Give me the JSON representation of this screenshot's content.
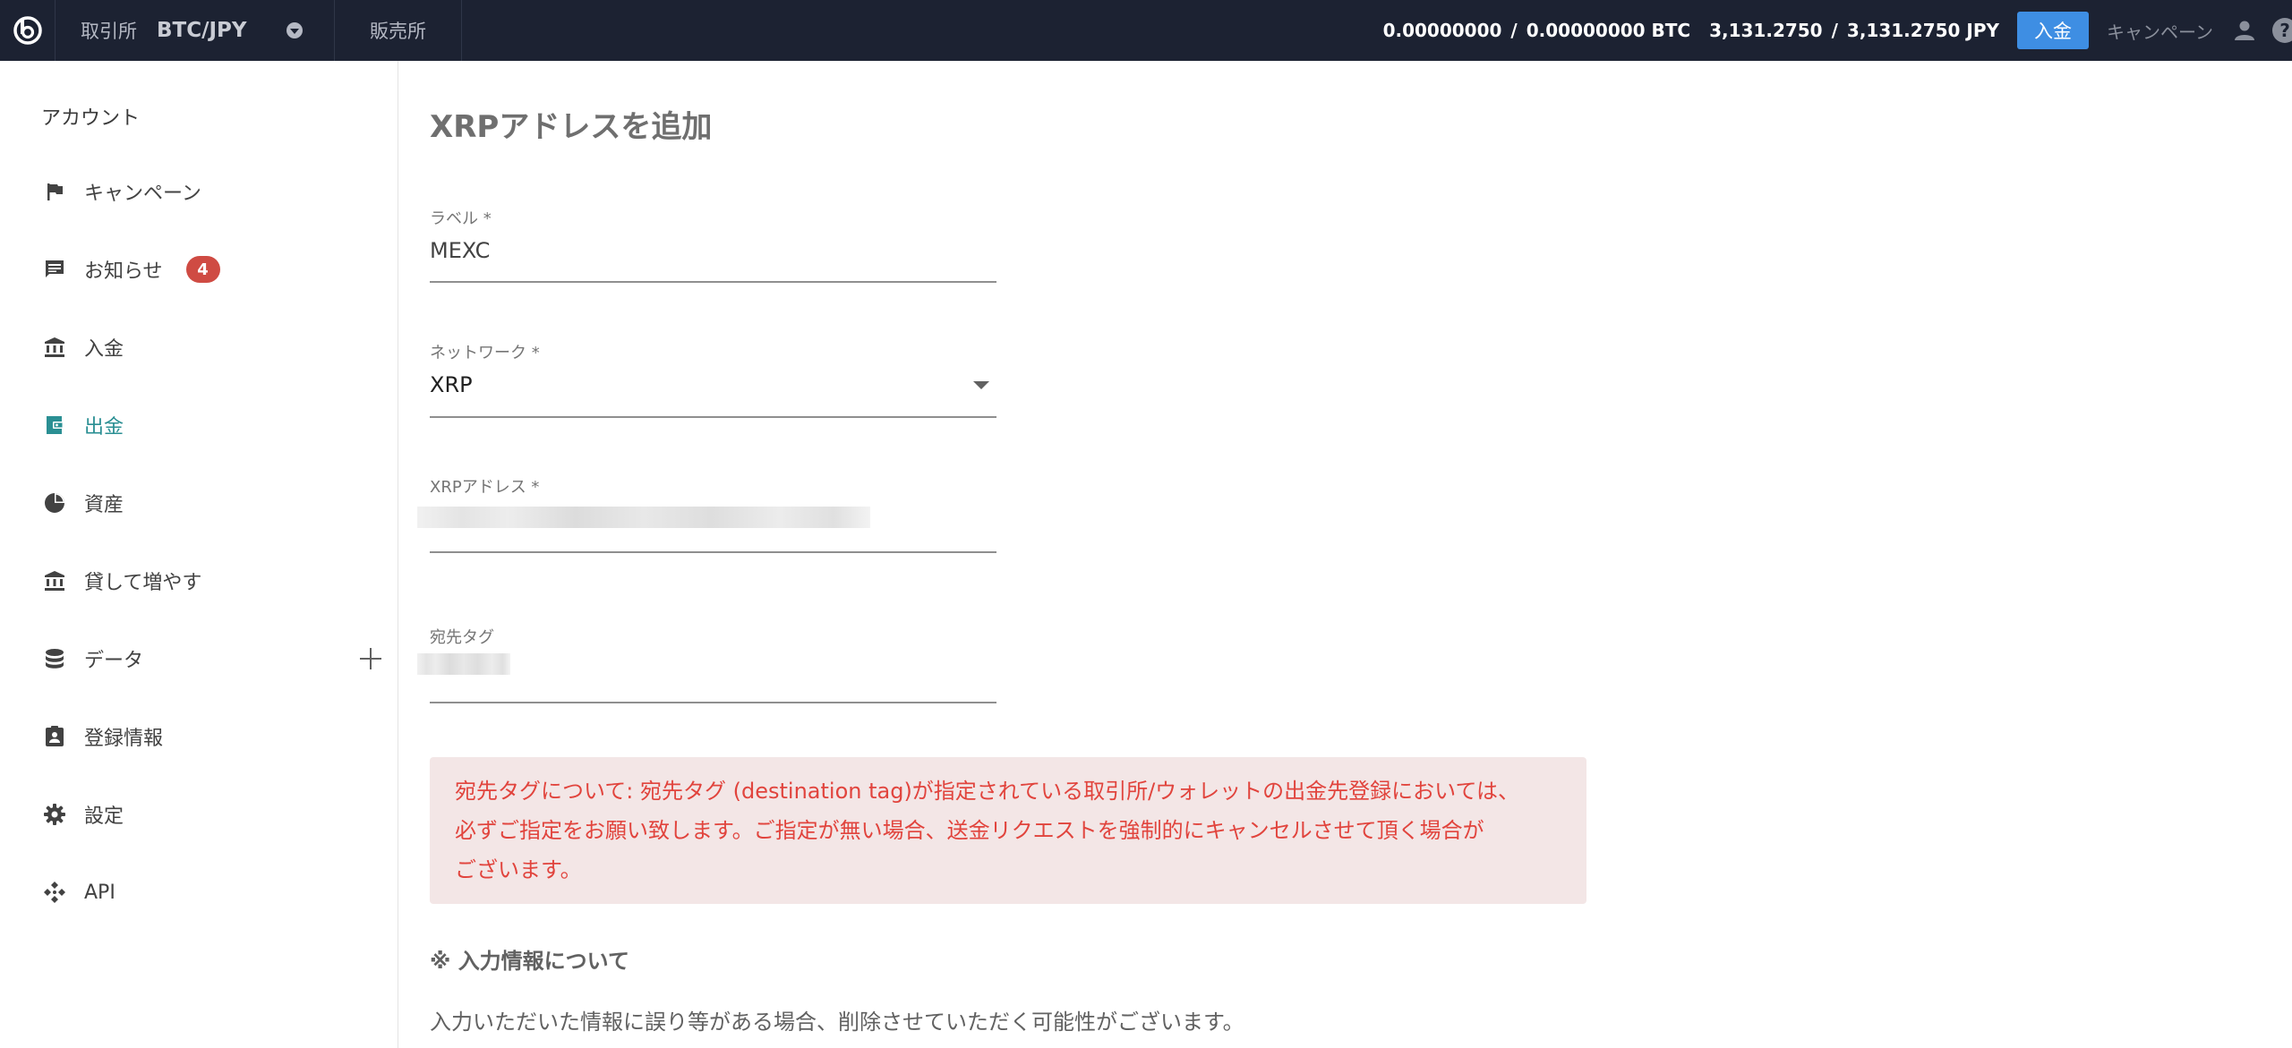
{
  "topbar": {
    "exchange_label": "取引所",
    "pair": "BTC/JPY",
    "shop_label": "販売所",
    "btc_available": "0.00000000",
    "btc_total": "0.00000000 BTC",
    "jpy_available": "3,131.2750",
    "jpy_total": "3,131.2750 JPY",
    "separator": "/",
    "deposit_button": "入金",
    "campaign_link": "キャンペーン",
    "help": "?"
  },
  "sidebar": {
    "title": "アカウント",
    "items": [
      {
        "label": "キャンペーン",
        "icon": "flag-icon"
      },
      {
        "label": "お知らせ",
        "icon": "message-icon",
        "badge": "4"
      },
      {
        "label": "入金",
        "icon": "bank-icon"
      },
      {
        "label": "出金",
        "icon": "wallet-icon",
        "active": true
      },
      {
        "label": "資産",
        "icon": "pie-chart-icon"
      },
      {
        "label": "貸して増やす",
        "icon": "bank-icon"
      },
      {
        "label": "データ",
        "icon": "database-icon"
      },
      {
        "label": "登録情報",
        "icon": "id-badge-icon"
      },
      {
        "label": "設定",
        "icon": "gear-icon"
      },
      {
        "label": "API",
        "icon": "api-icon"
      }
    ],
    "active_color": "#2a8f93"
  },
  "form": {
    "title": "XRPアドレスを追加",
    "label_field": {
      "label": "ラベル *",
      "value": "MEXC"
    },
    "network_field": {
      "label": "ネットワーク *",
      "value": "XRP"
    },
    "address_field": {
      "label": "XRPアドレス *",
      "value": ""
    },
    "tag_field": {
      "label": "宛先タグ",
      "value": ""
    }
  },
  "alert": {
    "line1": "宛先タグについて: 宛先タグ (destination tag)が指定されている取引所/ウォレットの出金先登録においては、",
    "line2": "必ずご指定をお願い致します。ご指定が無い場合、送金リクエストを強制的にキャンセルさせて頂く場合が",
    "line3": "ございます。",
    "color": "#e1443d"
  },
  "notes": {
    "title": "※ 入力情報について",
    "body": "入力いただいた情報に誤り等がある場合、削除させていただく可能性がございます。"
  }
}
